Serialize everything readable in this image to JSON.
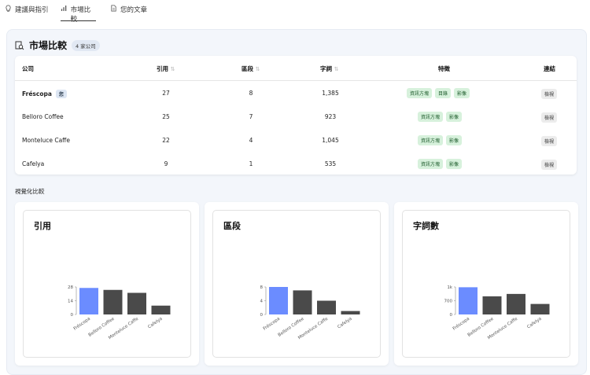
{
  "tabs": [
    {
      "label": "建議與指引",
      "icon": "lightbulb-icon"
    },
    {
      "label": "市場比較",
      "icon": "bar-chart-icon",
      "active": true
    },
    {
      "label": "您的文章",
      "icon": "document-icon"
    }
  ],
  "panel": {
    "title": "市場比較",
    "badge": "4 家公司"
  },
  "table": {
    "columns": [
      "公司",
      "引用",
      "區段",
      "字詞",
      "特徵",
      "連結"
    ],
    "rows": [
      {
        "company": "Fréscopa",
        "own_badge": "您",
        "citations": "27",
        "sections": "8",
        "words": "1,385",
        "features": [
          "資訊方塊",
          "目錄",
          "影像"
        ],
        "link": "檢視"
      },
      {
        "company": "Belloro Coffee",
        "citations": "25",
        "sections": "7",
        "words": "923",
        "features": [
          "資訊方塊",
          "影像"
        ],
        "link": "檢視"
      },
      {
        "company": "Monteluce Caffe",
        "citations": "22",
        "sections": "4",
        "words": "1,045",
        "features": [
          "資訊方塊",
          "影像"
        ],
        "link": "檢視"
      },
      {
        "company": "Cafelya",
        "citations": "9",
        "sections": "1",
        "words": "535",
        "features": [
          "資訊方塊",
          "影像"
        ],
        "link": "檢視"
      }
    ]
  },
  "visual_title": "視覺化比較",
  "colors": {
    "highlight": "#6b8cff",
    "bar": "#4a4a4a",
    "tag_bg": "#d7f1dc"
  },
  "chart_data": [
    {
      "type": "bar",
      "title": "引用",
      "categories": [
        "Fréscopa",
        "Belloro Coffee",
        "Monteluce Caffe",
        "Cafelya"
      ],
      "values": [
        27,
        25,
        22,
        9
      ],
      "ylim": [
        0,
        28
      ],
      "yticks": [
        "0",
        "14",
        "28"
      ],
      "ytick_values": [
        0,
        14,
        28
      ]
    },
    {
      "type": "bar",
      "title": "區段",
      "categories": [
        "Fréscopa",
        "Belloro Coffee",
        "Monteluce Caffe",
        "Cafelya"
      ],
      "values": [
        8,
        7,
        4,
        1
      ],
      "ylim": [
        0,
        8
      ],
      "yticks": [
        "0",
        "4",
        "8"
      ],
      "ytick_values": [
        0,
        4,
        8
      ]
    },
    {
      "type": "bar",
      "title": "字詞數",
      "categories": [
        "Fréscopa",
        "Belloro Coffee",
        "Monteluce Caffe",
        "Cafelya"
      ],
      "values": [
        1385,
        923,
        1045,
        535
      ],
      "ylim": [
        0,
        1400
      ],
      "yticks": [
        "0",
        "700",
        "1k"
      ],
      "ytick_values": [
        0,
        700,
        1400
      ]
    }
  ]
}
